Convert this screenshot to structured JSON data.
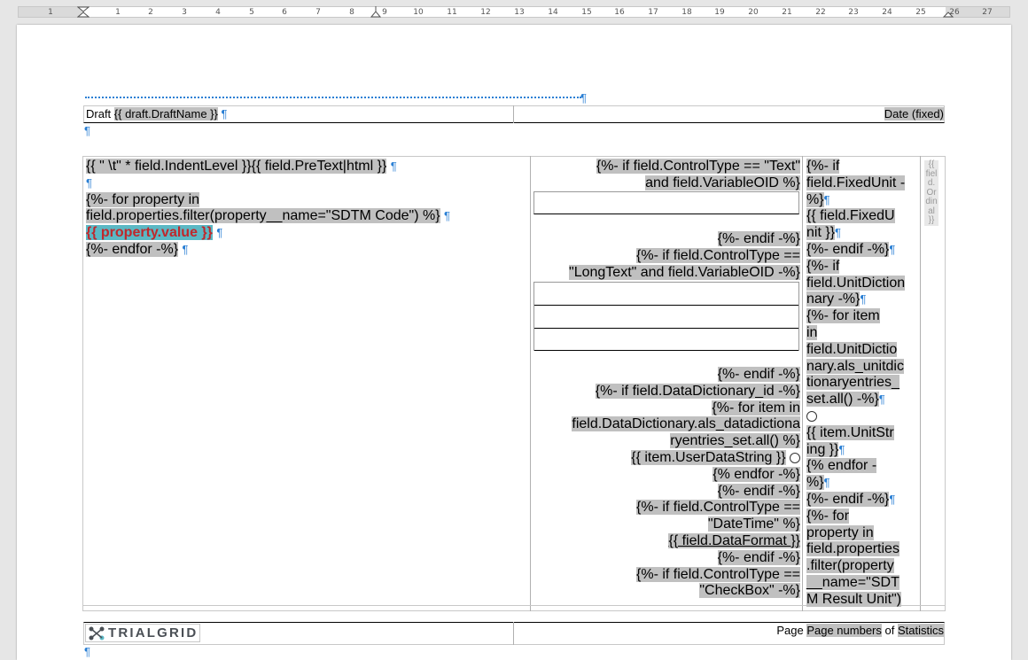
{
  "ruler": {
    "numbers": [
      "1",
      "1",
      "2",
      "3",
      "4",
      "5",
      "6",
      "7",
      "8",
      "9",
      "10",
      "11",
      "12",
      "13",
      "14",
      "15",
      "16",
      "17",
      "18",
      "19",
      "20",
      "21",
      "22",
      "23",
      "24",
      "25",
      "26",
      "27"
    ]
  },
  "pilcrow": "¶",
  "header": {
    "draft_label": "Draft",
    "draft_field": "{{ draft.DraftName }}",
    "date_field": "Date (fixed)"
  },
  "col1": {
    "line1_a": "{{ \" \\t\" * field.IndentLevel }}",
    "line1_b": "{{ field.PreText|html }}",
    "line2": "{%- for property in",
    "line3": "field.properties.filter(property__name=\"SDTM Code\") %}",
    "line4": "{{ property.value }}",
    "line5": "{%- endfor -%}"
  },
  "col2": {
    "l1": "{%- if field.ControlType == \"Text\"",
    "l2": "and field.VariableOID %}",
    "l3": "{%- endif -%}",
    "l4": "{%- if field.ControlType ==",
    "l5": "\"LongText\" and field.VariableOID -%}",
    "l6": "{%- endif -%}",
    "l7": "{%- if field.DataDictionary_id -%}",
    "l8": "{%- for item in",
    "l9": "field.DataDictionary.als_datadictiona",
    "l10": "ryentries_set.all() %}",
    "l11": "{{ item.UserDataString }}",
    "l12": "{% endfor -%}",
    "l13": "{%- endif -%}",
    "l14": "{%- if field.ControlType ==",
    "l15": "\"DateTime\" %}",
    "l16": "{{ field.DataFormat }}",
    "l17": "{%- endif -%}",
    "l18": "{%- if field.ControlType ==",
    "l19": "\"CheckBox\" -%}"
  },
  "col3": {
    "l1": "{%- if",
    "l2": "field.FixedUnit -",
    "l3": "%}",
    "l4": "{{ field.FixedU",
    "l5": "nit }}",
    "l6": "{%- endif -%}",
    "l7": "{%- if",
    "l8": "field.UnitDiction",
    "l9": "nary -%}",
    "l10": "{%- for item",
    "l11": "in",
    "l12": "field.UnitDictio",
    "l13": "nary.als_unitdic",
    "l14": "tionaryentries_",
    "l15": "set.all() -%}",
    "l16": "{{ item.UnitStr",
    "l17": "ing }}",
    "l18": "{% endfor -",
    "l19": "%}",
    "l20": "{%- endif -%}",
    "l21": "{%- for",
    "l22": "property in",
    "l23": "field.properties",
    "l24": ".filter(property",
    "l25": "__name=\"SDT",
    "l26": "M Result Unit\")"
  },
  "col4": {
    "lines": [
      "{{",
      "fiel",
      "d.",
      "Or",
      "din",
      "al",
      "}}"
    ]
  },
  "footer": {
    "logo_text": "TRIALGRID",
    "page_label": "Page",
    "page_numbers_field": "Page numbers",
    "of_label": "of",
    "statistics_field": "Statistics"
  },
  "colors": {
    "field_shade": "#c0c0c0",
    "pilcrow": "#2a7fd4",
    "property_value_bg": "#5bb8c4",
    "property_value_text": "#c0282c"
  }
}
